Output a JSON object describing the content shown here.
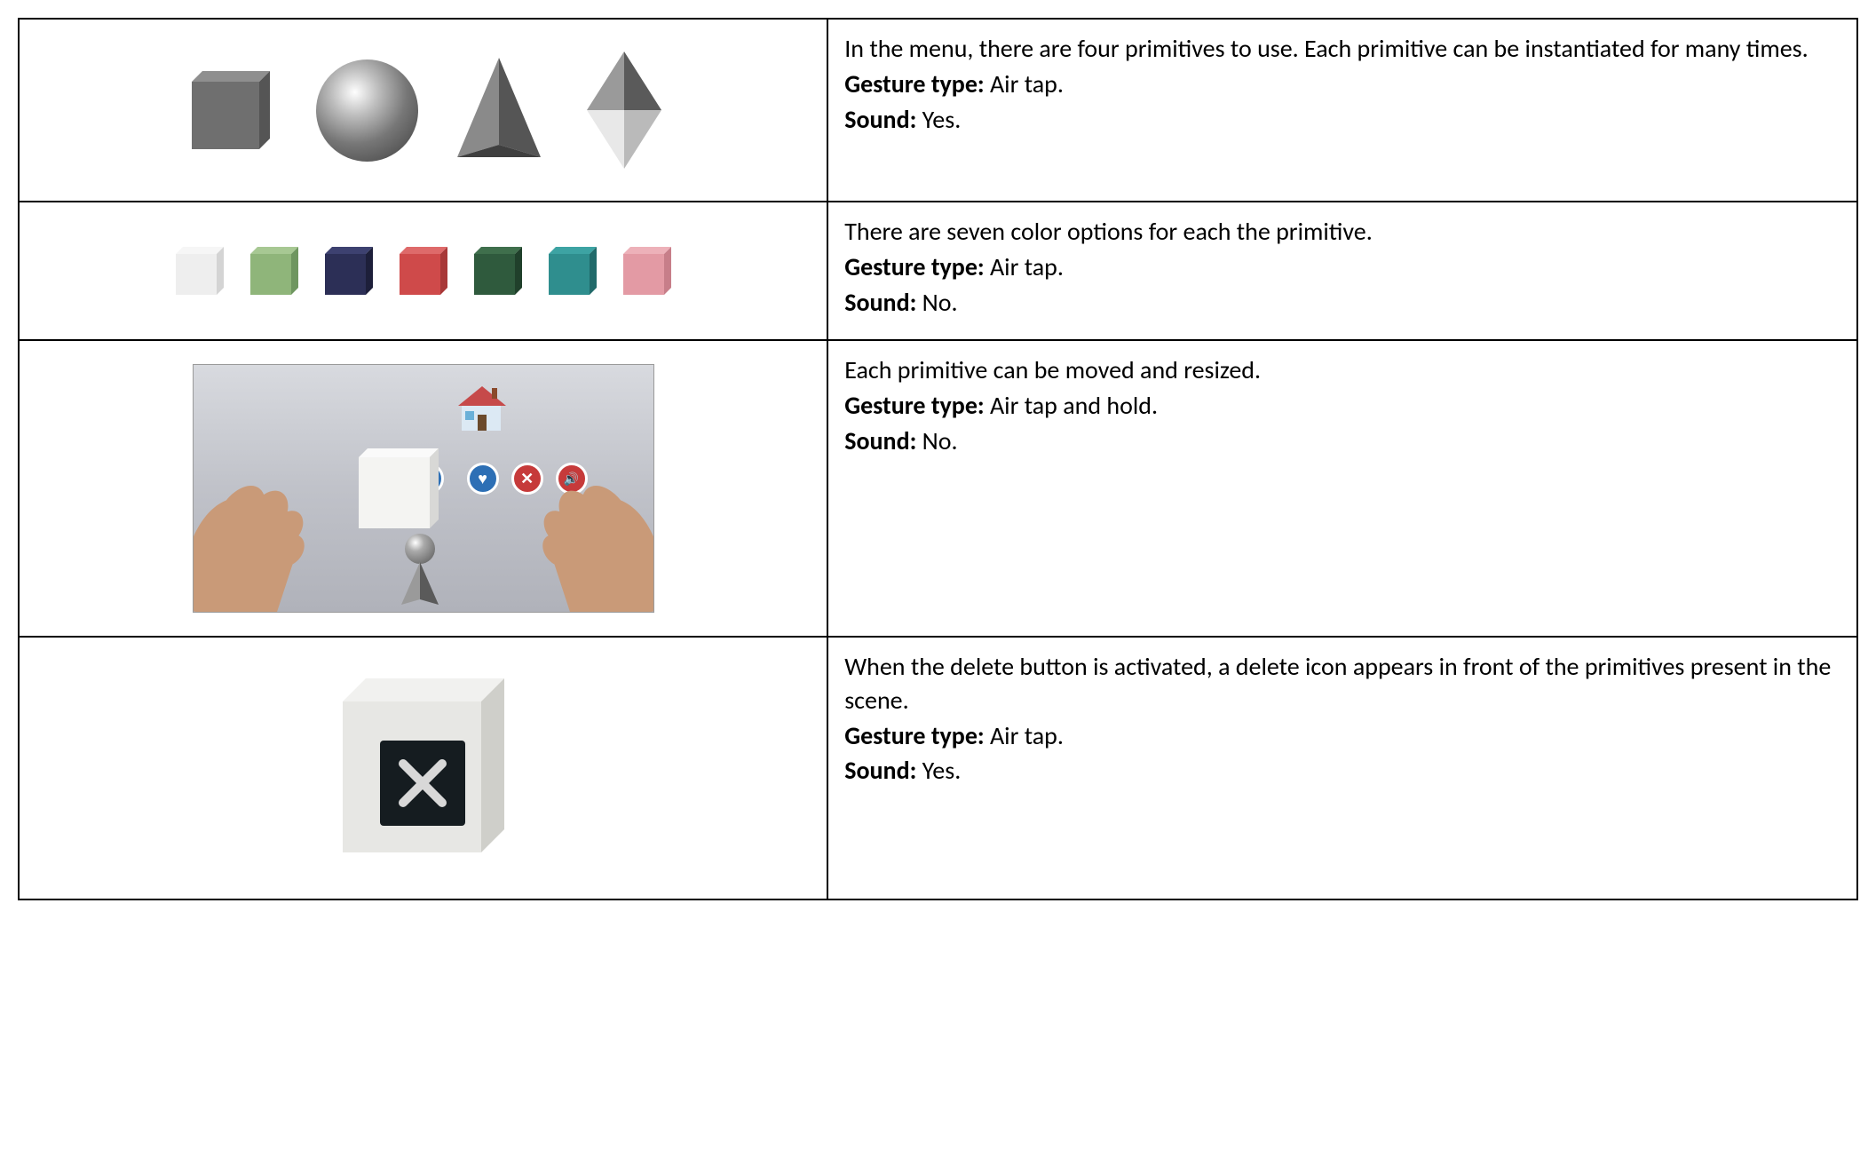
{
  "rows": [
    {
      "description": "In the menu, there are four primitives to use. Each primitive can be instantiated for many times.",
      "gesture_label": "Gesture type:",
      "gesture_value": "Air tap.",
      "sound_label": "Sound:",
      "sound_value": "Yes.",
      "primitives": [
        "cube",
        "sphere",
        "pyramid",
        "octahedron"
      ]
    },
    {
      "description": "There are seven color options for each the primitive.",
      "gesture_label": "Gesture type:",
      "gesture_value": "Air tap.",
      "sound_label": "Sound:",
      "sound_value": "No.",
      "colors": [
        "#eeeeee",
        "#8fb57a",
        "#2c2f56",
        "#cf4a4a",
        "#2f5a3d",
        "#2f8e8e",
        "#e39aa4"
      ]
    },
    {
      "description": "Each primitive can be moved and resized.",
      "gesture_label": "Gesture type:",
      "gesture_value": "Air tap and hold.",
      "sound_label": "Sound:",
      "sound_value": "No.",
      "scene_buttons": [
        {
          "name": "add-icon",
          "bg": "#3fa83f",
          "glyph": "+"
        },
        {
          "name": "refresh-icon",
          "bg": "#2d6fb5",
          "glyph": "⟳"
        },
        {
          "name": "heart-icon",
          "bg": "#2d6fb5",
          "glyph": "♥"
        },
        {
          "name": "close-icon",
          "bg": "#c63a3a",
          "glyph": "✕"
        },
        {
          "name": "sound-icon",
          "bg": "#c63a3a",
          "glyph": "🔊"
        }
      ]
    },
    {
      "description": "When the delete button is activated, a delete icon appears in front of the primitives present in the scene.",
      "gesture_label": "Gesture type:",
      "gesture_value": "Air tap.",
      "sound_label": "Sound:",
      "sound_value": "Yes."
    }
  ]
}
